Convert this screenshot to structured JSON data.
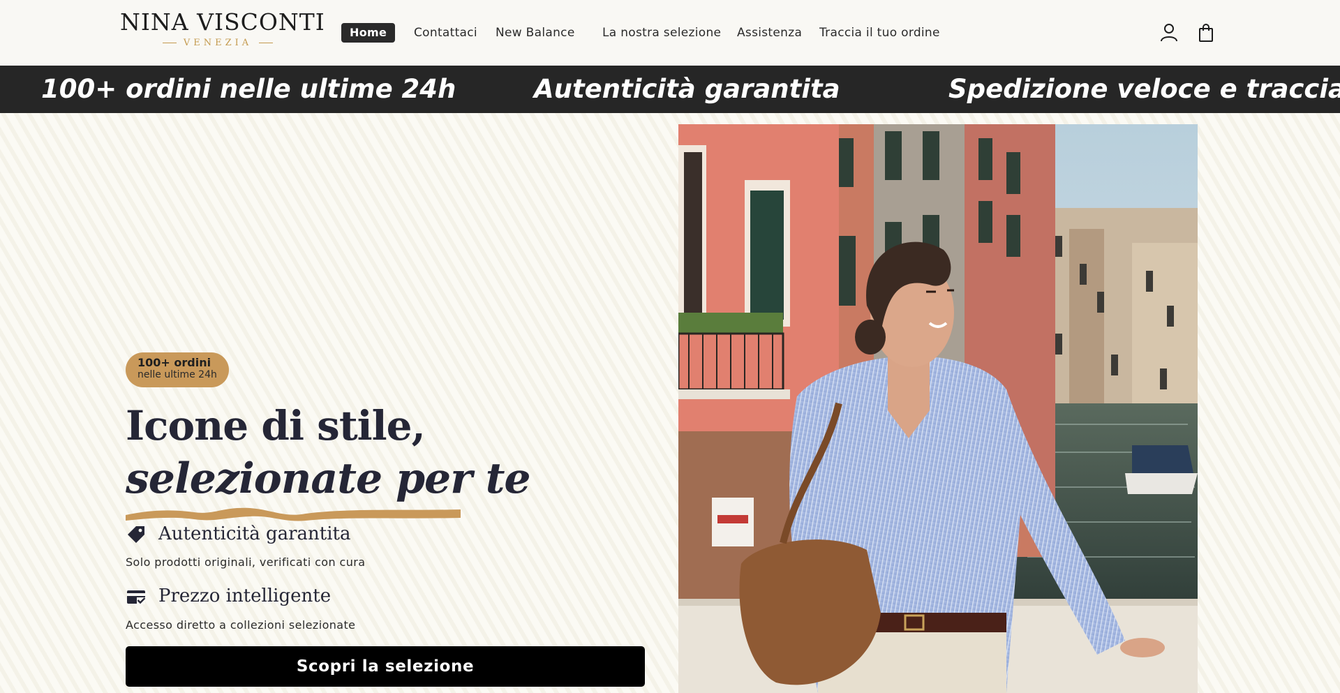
{
  "header": {
    "logo_main": "NINA VISCONTI",
    "logo_sub": "VENEZIA",
    "nav": [
      "Home",
      "Contattaci",
      "New Balance",
      "La nostra selezione",
      "Assistenza",
      "Traccia il tuo ordine"
    ],
    "active_nav": "Home",
    "icons": [
      "account-icon",
      "cart-icon"
    ]
  },
  "marquee": [
    "100+ ordini nelle ultime 24h",
    "Autenticità garantita",
    "Spedizione veloce e tracciata"
  ],
  "hero": {
    "badge_title": "100+ ordini",
    "badge_sub": "nelle ultime 24h",
    "headline_1": "Icone di stile,",
    "headline_2": "selezionate per te",
    "features": [
      {
        "icon": "tag-icon",
        "title": "Autenticità garantita",
        "text": "Solo prodotti originali, verificati con cura"
      },
      {
        "icon": "card-check-icon",
        "title": "Prezzo intelligente",
        "text": "Accesso diretto a collezioni selezionate"
      }
    ],
    "cta": "Scopri la selezione",
    "image": "woman-in-venice-photo"
  },
  "colors": {
    "accent_gold": "#c9995a",
    "dark": "#262626",
    "headline": "#252636",
    "background": "#fbfaf4"
  }
}
